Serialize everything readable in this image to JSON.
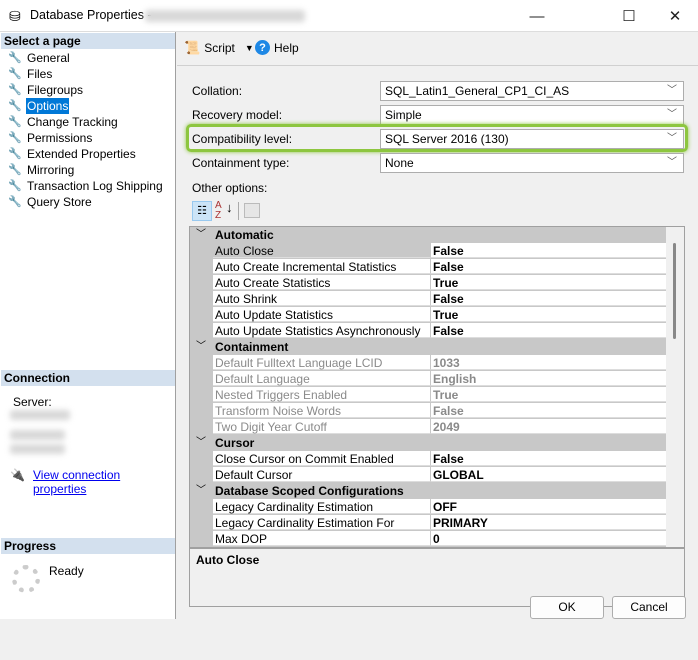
{
  "window": {
    "title": "Database Properties -",
    "icon": "database-icon"
  },
  "left": {
    "select_header": "Select a page",
    "pages": [
      "General",
      "Files",
      "Filegroups",
      "Options",
      "Change Tracking",
      "Permissions",
      "Extended Properties",
      "Mirroring",
      "Transaction Log Shipping",
      "Query Store"
    ],
    "selected": "Options",
    "connection_header": "Connection",
    "server_label": "Server:",
    "view_connection_link": "View connection properties",
    "progress_header": "Progress",
    "progress_status": "Ready"
  },
  "toolbar": {
    "script": "Script",
    "help": "Help"
  },
  "form": {
    "collation_label": "Collation:",
    "collation": "SQL_Latin1_General_CP1_CI_AS",
    "recovery_label": "Recovery model:",
    "recovery": "Simple",
    "compat_label": "Compatibility level:",
    "compat": "SQL Server 2016 (130)",
    "containment_label": "Containment type:",
    "containment": "None",
    "other_label": "Other options:",
    "highlight_color": "#8dc63f"
  },
  "grid": {
    "automatic": "Automatic",
    "auto": [
      [
        "Auto Close",
        "False"
      ],
      [
        "Auto Create Incremental Statistics",
        "False"
      ],
      [
        "Auto Create Statistics",
        "True"
      ],
      [
        "Auto Shrink",
        "False"
      ],
      [
        "Auto Update Statistics",
        "True"
      ],
      [
        "Auto Update Statistics Asynchronously",
        "False"
      ]
    ],
    "containment": "Containment",
    "cont": [
      [
        "Default Fulltext Language LCID",
        "1033"
      ],
      [
        "Default Language",
        "English"
      ],
      [
        "Nested Triggers Enabled",
        "True"
      ],
      [
        "Transform Noise Words",
        "False"
      ],
      [
        "Two Digit Year Cutoff",
        "2049"
      ]
    ],
    "cursor": "Cursor",
    "cur": [
      [
        "Close Cursor on Commit Enabled",
        "False"
      ],
      [
        "Default Cursor",
        "GLOBAL"
      ]
    ],
    "dsc": "Database Scoped Configurations",
    "dscr": [
      [
        "Legacy Cardinality Estimation",
        "OFF"
      ],
      [
        "Legacy Cardinality Estimation For Secondary",
        "PRIMARY"
      ],
      [
        "Max DOP",
        "0"
      ]
    ]
  },
  "description": "Auto Close",
  "buttons": {
    "ok": "OK",
    "cancel": "Cancel"
  }
}
